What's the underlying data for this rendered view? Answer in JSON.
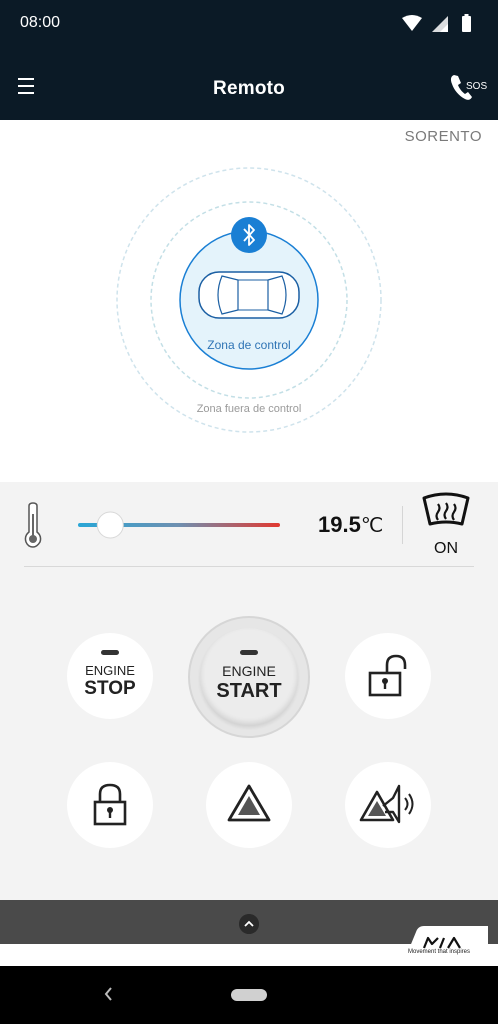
{
  "status_bar": {
    "time": "08:00",
    "icons": [
      "wifi-icon",
      "signal-icon",
      "battery-icon"
    ]
  },
  "header": {
    "title": "Remoto",
    "sos_label": "SOS"
  },
  "control_zone": {
    "vehicle_name": "SORENTO",
    "inner_zone_label": "Zona de control",
    "outer_zone_label": "Zona fuera de control",
    "connection_icon": "bluetooth-icon"
  },
  "climate": {
    "temperature_value": "19.5",
    "temperature_unit": "℃",
    "slider_fraction": 0.16,
    "defrost_label": "ON"
  },
  "buttons": {
    "engine_stop": {
      "line1": "ENGINE",
      "line2": "STOP"
    },
    "engine_start": {
      "line1": "ENGINE",
      "line2": "START"
    },
    "unlock_icon": "unlock-icon",
    "lock_icon": "lock-icon",
    "hazard_icon": "hazard-icon",
    "horn_icon": "hazard-horn-icon"
  },
  "footer": {
    "tagline": "Movement that inspires"
  },
  "colors": {
    "header_bg": "#0b1a26",
    "accent_blue": "#1a7fd4",
    "slider_cold": "#29a6d6",
    "slider_hot": "#e2382f"
  }
}
